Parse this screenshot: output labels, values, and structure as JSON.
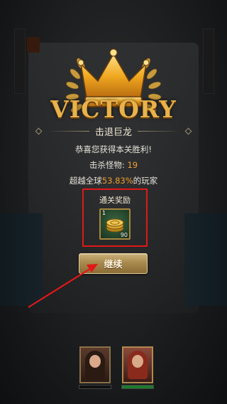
{
  "result": {
    "title": "VICTORY",
    "subtitle": "击退巨龙"
  },
  "messages": {
    "congrats": "恭喜您获得本关胜利!",
    "kills_label": "击杀怪物:",
    "kills_value": "19",
    "beat_prefix": "超越全球",
    "beat_percent": "53.83%",
    "beat_suffix": "的玩家"
  },
  "reward": {
    "title": "通关奖励",
    "item_icon": "gold-coins-icon",
    "qty_top": "1",
    "qty_bottom": "90"
  },
  "actions": {
    "continue_label": "继续"
  },
  "heroes": [
    {
      "name": "hero-1",
      "hp_fraction": 0.0
    },
    {
      "name": "hero-2",
      "hp_fraction": 1.0
    }
  ],
  "colors": {
    "accent_gold": "#e9b24a",
    "highlight_orange": "#f0a030",
    "annotation_red": "#e01818"
  }
}
